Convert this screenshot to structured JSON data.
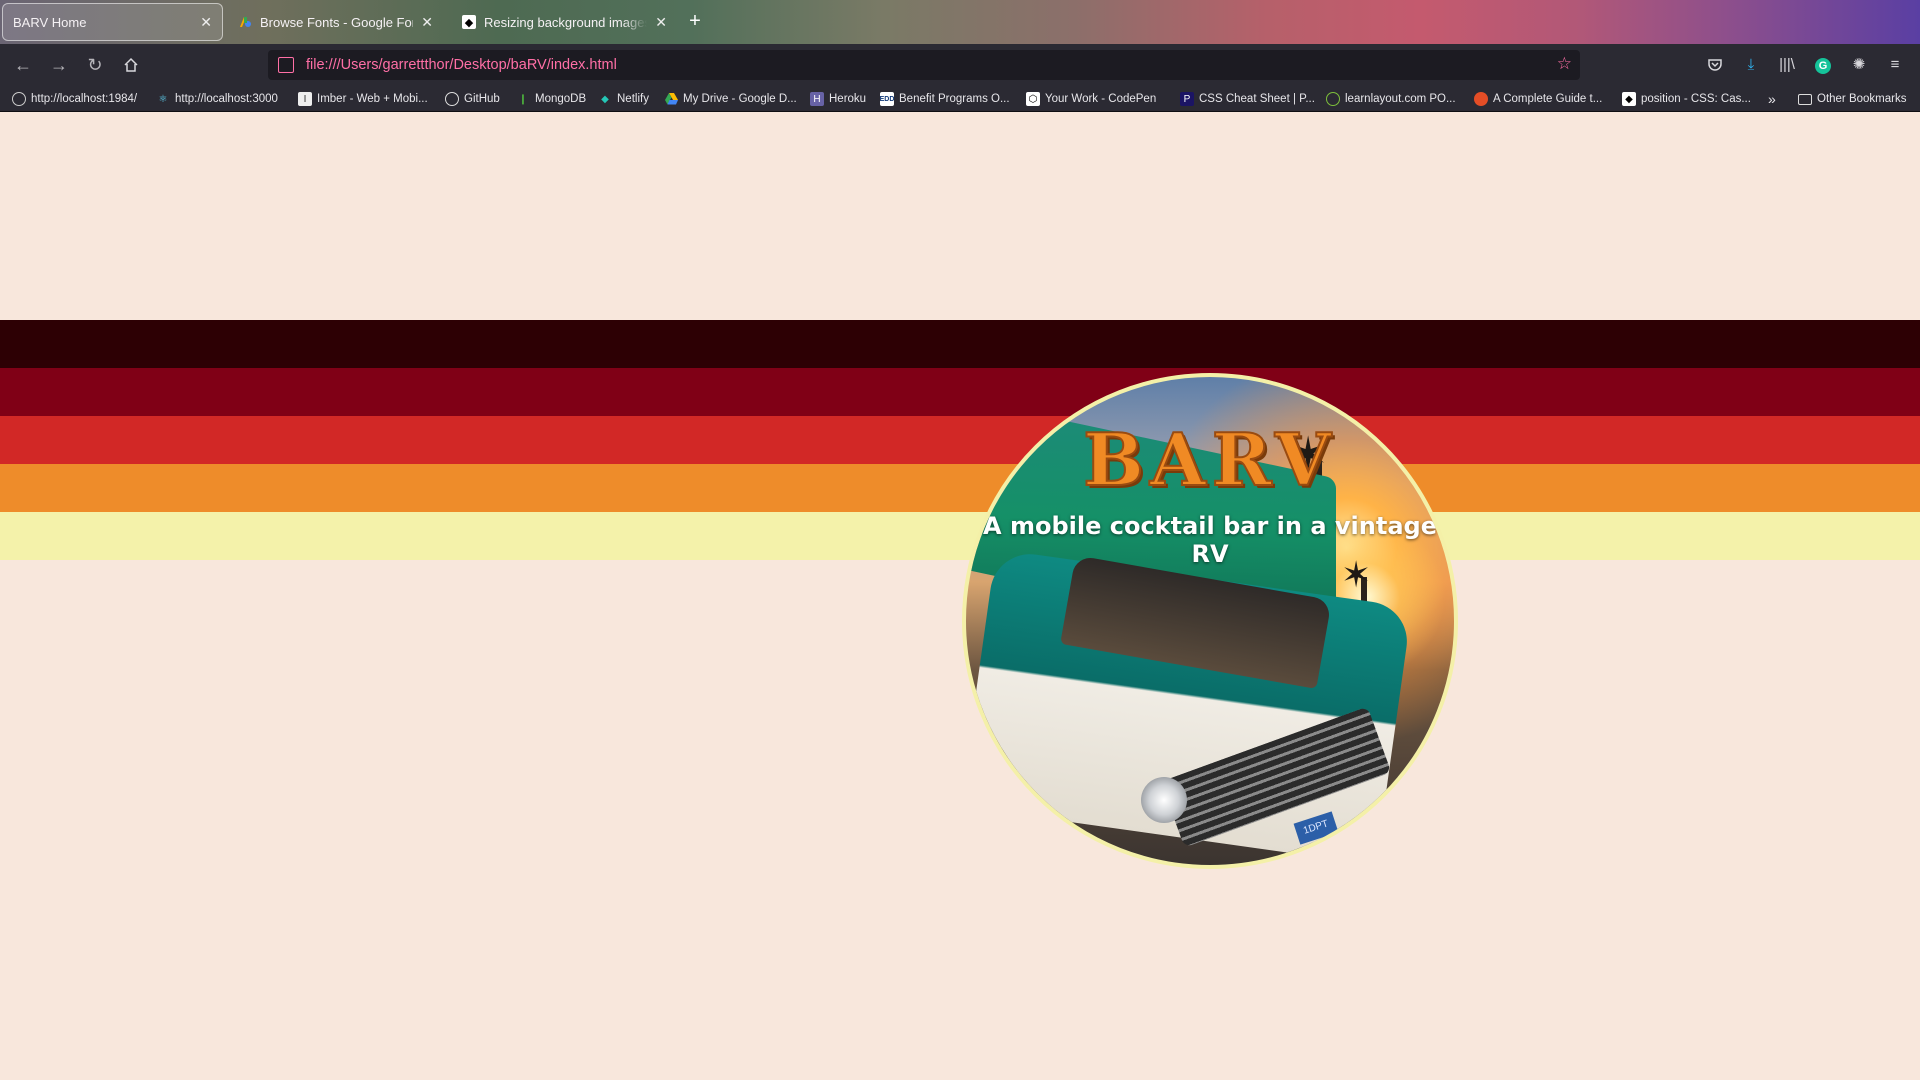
{
  "browser": {
    "tabs": [
      {
        "title": "BARV Home",
        "active": true,
        "favicon": "blank-icon"
      },
      {
        "title": "Browse Fonts - Google Fonts",
        "active": false,
        "favicon": "google-fonts-icon"
      },
      {
        "title": "Resizing background images wi",
        "active": false,
        "favicon": "mdn-icon"
      }
    ],
    "new_tab_icon": "plus-icon",
    "nav": {
      "url": "file:///Users/garrettthor/Desktop/baRV/index.html",
      "back_icon": "arrow-left-icon",
      "forward_icon": "arrow-right-icon",
      "reload_icon": "reload-icon",
      "home_icon": "home-icon",
      "bookmark_star_icon": "star-icon",
      "toolbar_icons": [
        "pocket-icon",
        "download-icon",
        "library-icon",
        "grammarly-icon",
        "extension-icon",
        "menu-icon"
      ]
    },
    "bookmarks": [
      {
        "label": "http://localhost:1984/",
        "icon": "globe-icon"
      },
      {
        "label": "http://localhost:3000",
        "icon": "react-icon"
      },
      {
        "label": "Imber - Web + Mobi...",
        "icon": "imber-icon"
      },
      {
        "label": "GitHub",
        "icon": "github-icon"
      },
      {
        "label": "MongoDB",
        "icon": "mongodb-icon"
      },
      {
        "label": "Netlify",
        "icon": "netlify-icon"
      },
      {
        "label": "My Drive - Google D...",
        "icon": "google-drive-icon"
      },
      {
        "label": "Heroku",
        "icon": "heroku-icon"
      },
      {
        "label": "Benefit Programs O...",
        "icon": "edd-icon"
      },
      {
        "label": "Your Work - CodePen",
        "icon": "codepen-icon"
      },
      {
        "label": "CSS Cheat Sheet | P...",
        "icon": "css-icon"
      },
      {
        "label": "learnlayout.com PO...",
        "icon": "learnlayout-icon"
      },
      {
        "label": "A Complete Guide t...",
        "icon": "css-tricks-icon"
      },
      {
        "label": "position - CSS: Cas...",
        "icon": "mdn-icon"
      }
    ],
    "overflow_icon": "double-chevron-right-icon",
    "other_bookmarks": {
      "label": "Other Bookmarks",
      "icon": "folder-icon"
    }
  },
  "page": {
    "background": "#f8e7dc",
    "stripes": [
      "#2d0004",
      "#800016",
      "#d22826",
      "#ee8c2a",
      "#f4f2aa"
    ],
    "logo": {
      "title": "BARV",
      "tagline": "A mobile cocktail bar in a vintage RV",
      "border_color": "#f4f0a8",
      "plate_text": "1DPT"
    }
  }
}
